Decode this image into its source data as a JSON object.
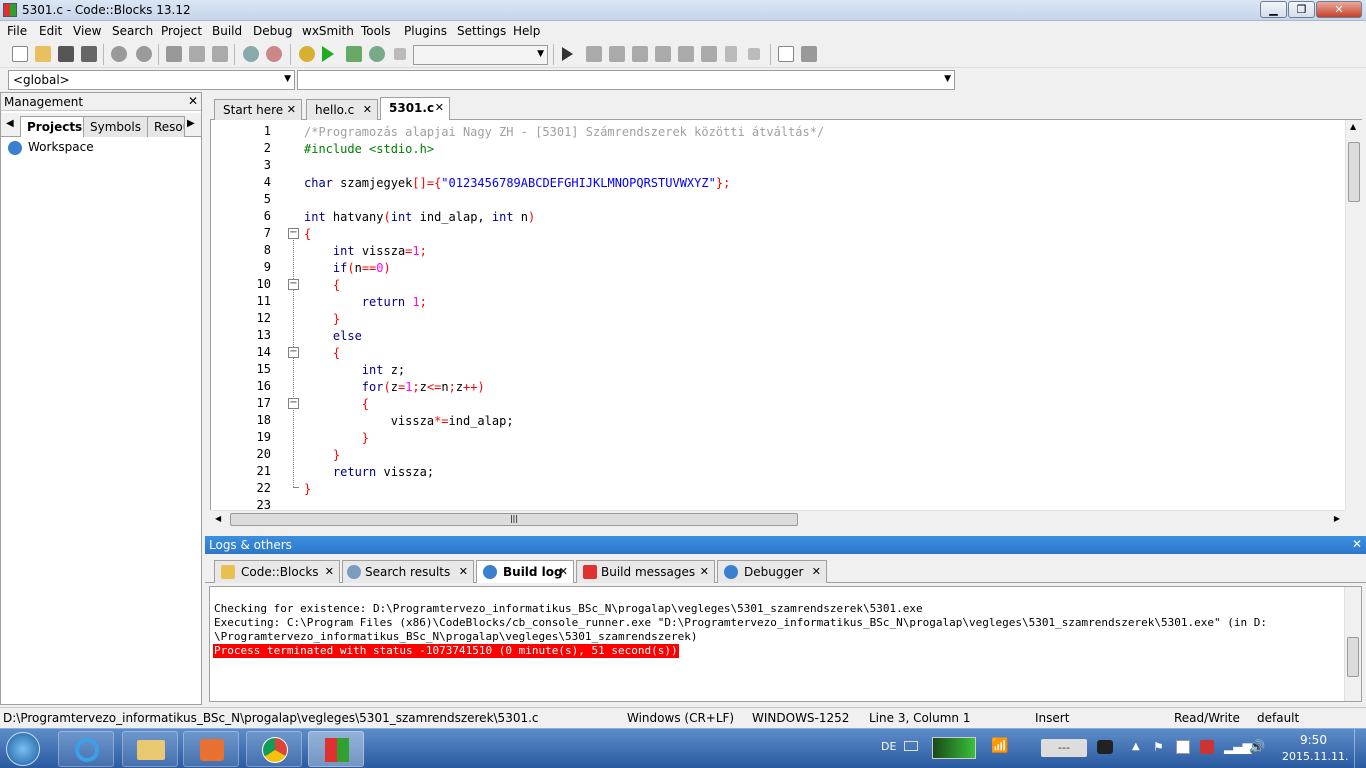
{
  "window": {
    "title": "5301.c - Code::Blocks 13.12",
    "min": "▁",
    "max": "❐",
    "close": "✕"
  },
  "menu": [
    "File",
    "Edit",
    "View",
    "Search",
    "Project",
    "Build",
    "Debug",
    "wxSmith",
    "Tools",
    "Plugins",
    "Settings",
    "Help"
  ],
  "codebar": {
    "scope": "<global>",
    "symbol": ""
  },
  "management": {
    "title": "Management",
    "close": "✕",
    "tabs": [
      "Projects",
      "Symbols",
      "Resou"
    ],
    "tree_root": "Workspace"
  },
  "editor_tabs": [
    {
      "label": "Start here",
      "close": "✕"
    },
    {
      "label": "hello.c",
      "close": "✕"
    },
    {
      "label": "5301.c",
      "close": "✕"
    }
  ],
  "code_lines": [
    {
      "n": "1"
    },
    {
      "n": "2"
    },
    {
      "n": "3"
    },
    {
      "n": "4"
    },
    {
      "n": "5"
    },
    {
      "n": "6"
    },
    {
      "n": "7"
    },
    {
      "n": "8"
    },
    {
      "n": "9"
    },
    {
      "n": "10"
    },
    {
      "n": "11"
    },
    {
      "n": "12"
    },
    {
      "n": "13"
    },
    {
      "n": "14"
    },
    {
      "n": "15"
    },
    {
      "n": "16"
    },
    {
      "n": "17"
    },
    {
      "n": "18"
    },
    {
      "n": "19"
    },
    {
      "n": "20"
    },
    {
      "n": "21"
    },
    {
      "n": "22"
    },
    {
      "n": "23"
    }
  ],
  "code": {
    "l1": "/*Programozás alapjai Nagy ZH - [5301] Számrendszerek közötti átváltás*/",
    "l2": "#include <stdio.h>",
    "l4_type": "char",
    "l4_name": " szamjegyek",
    "l4_br": "[]={",
    "l4_str": "\"0123456789ABCDEFGHIJKLMNOPQRSTUVWXYZ\"",
    "l4_end": "};",
    "l6_int": "int",
    "l6_name": " hatvany",
    "l6_p1": "(",
    "l6_int2": "int",
    "l6_a": " ind_alap, ",
    "l6_int3": "int",
    "l6_n": " n",
    "l6_p2": ")",
    "l7": "{",
    "l8_int": "int",
    "l8_rest": " vissza",
    "l8_eq": "=",
    "l8_num": "1",
    "l8_sc": ";",
    "l9_if": "if",
    "l9_p": "(",
    "l9_n": "n",
    "l9_op": "==",
    "l9_num": "0",
    "l9_p2": ")",
    "l10": "{",
    "l11_ret": "return",
    "l11_num": " 1",
    "l11_sc": ";",
    "l12": "}",
    "l13": "else",
    "l14": "{",
    "l15_int": "int",
    "l15_rest": " z;",
    "l16_for": "for",
    "l16_p": "(",
    "l16_z": "z",
    "l16_eq": "=",
    "l16_one": "1",
    "l16_sc": ";",
    "l16_z2": "z",
    "l16_le": "<=",
    "l16_n": "n",
    "l16_sc2": ";",
    "l16_z3": "z",
    "l16_pp": "++",
    "l16_p2": ")",
    "l17": "{",
    "l18_a": "vissza",
    "l18_op": "*=",
    "l18_b": "ind_alap;",
    "l19": "}",
    "l20": "}",
    "l21_ret": "return",
    "l21_rest": " vissza;",
    "l22": "}"
  },
  "logs": {
    "title": "Logs & others",
    "close": "✕",
    "tabs": [
      {
        "label": "Code::Blocks",
        "close": "✕"
      },
      {
        "label": "Search results",
        "close": "✕"
      },
      {
        "label": "Build log",
        "close": "✕"
      },
      {
        "label": "Build messages",
        "close": "✕"
      },
      {
        "label": "Debugger",
        "close": "✕"
      }
    ],
    "lines": [
      "Checking for existence: D:\\Programtervezo_informatikus_BSc_N\\progalap\\vegleges\\5301_szamrendszerek\\5301.exe",
      "Executing: C:\\Program Files (x86)\\CodeBlocks/cb_console_runner.exe \"D:\\Programtervezo_informatikus_BSc_N\\progalap\\vegleges\\5301_szamrendszerek\\5301.exe\" (in D:",
      "\\Programtervezo_informatikus_BSc_N\\progalap\\vegleges\\5301_szamrendszerek)",
      "Process terminated with status -1073741510 (0 minute(s), 51 second(s))"
    ]
  },
  "status": {
    "path": "D:\\Programtervezo_informatikus_BSc_N\\progalap\\vegleges\\5301_szamrendszerek\\5301.c",
    "eol": "Windows (CR+LF)",
    "encoding": "WINDOWS-1252",
    "position": "Line 3, Column 1",
    "mode": "Insert",
    "access": "Read/Write",
    "profile": "default"
  },
  "taskbar": {
    "lang": "DE",
    "time": "9:50",
    "date": "2015.11.11.",
    "tray_box": "---"
  }
}
